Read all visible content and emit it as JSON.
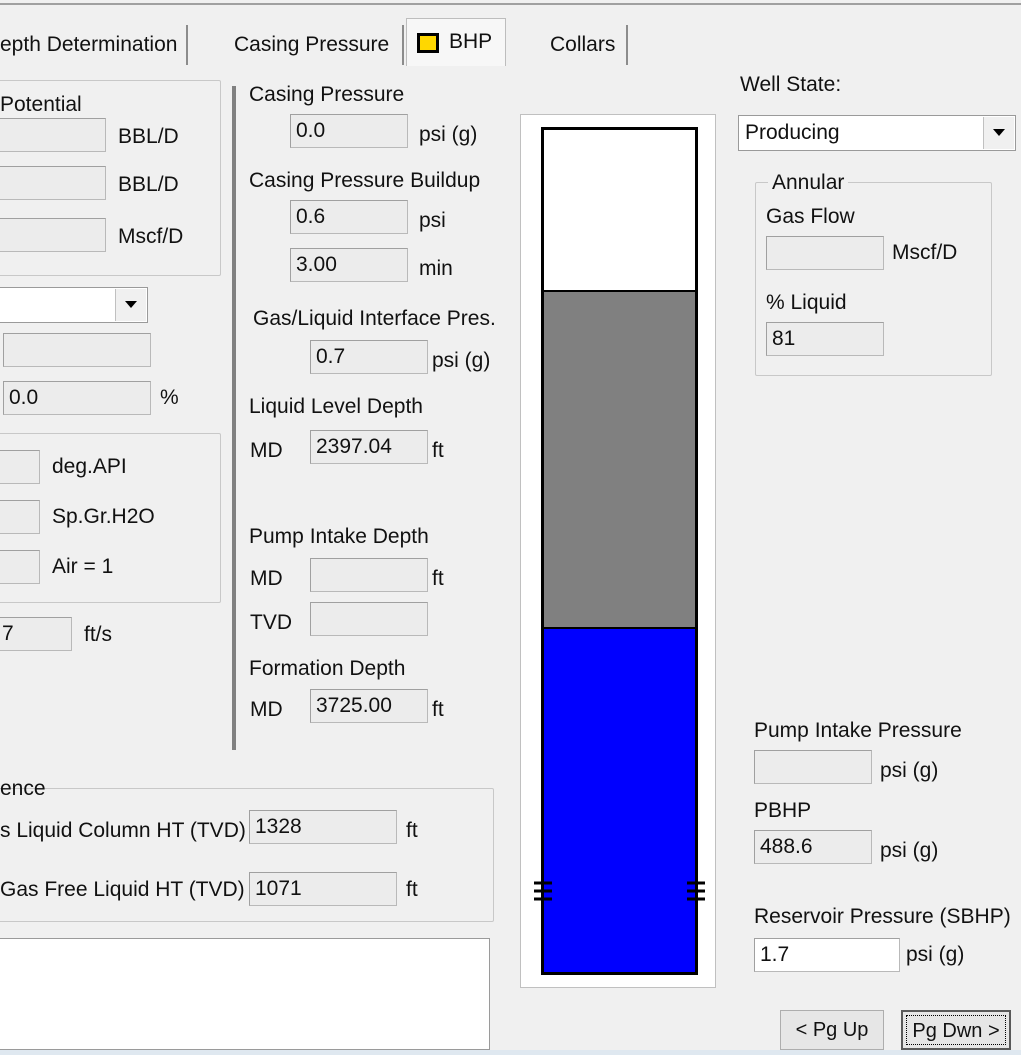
{
  "tabs": {
    "depth": "epth Determination",
    "casing": "Casing Pressure",
    "bhp": "BHP",
    "collars": "Collars"
  },
  "potential": {
    "legend": "Potential",
    "unit1": "BBL/D",
    "unit2": "BBL/D",
    "unit3": "Mscf/D"
  },
  "left": {
    "value_pct": "0.0",
    "pct_unit": "%",
    "unit_api": "deg.API",
    "unit_spgr": "Sp.Gr.H2O",
    "unit_air": "Air = 1",
    "velocity_value": "7",
    "velocity_unit": "ft/s"
  },
  "casing": {
    "title": "Casing Pressure",
    "value": "0.0",
    "unit": "psi (g)",
    "buildup_title": "Casing Pressure Buildup",
    "buildup_value": "0.6",
    "buildup_unit": "psi",
    "time_value": "3.00",
    "time_unit": "min",
    "interface_title": "Gas/Liquid Interface Pres.",
    "interface_value": "0.7",
    "interface_unit": "psi (g)"
  },
  "liquid_level": {
    "title": "Liquid Level Depth",
    "md_label": "MD",
    "md_value": "2397.04",
    "unit": "ft"
  },
  "pump_intake": {
    "title": "Pump Intake Depth",
    "md_label": "MD",
    "md_value": "",
    "unit": "ft",
    "tvd_label": "TVD",
    "tvd_value": ""
  },
  "formation": {
    "title": "Formation Depth",
    "md_label": "MD",
    "md_value": "3725.00",
    "unit": "ft"
  },
  "reference": {
    "legend": "ence",
    "row1_label": "s Liquid Column HT (TVD)",
    "row1_value": "1328",
    "row1_unit": "ft",
    "row2_label": "Gas Free Liquid HT (TVD)",
    "row2_value": "1071",
    "row2_unit": "ft"
  },
  "well_column": {
    "gas_fraction": 0.19,
    "liquid_gas_fraction": 0.4,
    "liquid_fraction": 0.41,
    "colors": {
      "top": "#ffffff",
      "gas": "#808080",
      "liquid": "#0000ff"
    }
  },
  "well_state": {
    "label": "Well State:",
    "value": "Producing"
  },
  "annular": {
    "legend": "Annular",
    "gas_flow_label": "Gas Flow",
    "gas_flow_value": "",
    "gas_flow_unit": "Mscf/D",
    "pct_liquid_label": "% Liquid",
    "pct_liquid_value": "81"
  },
  "pressures": {
    "pip_label": "Pump Intake Pressure",
    "pip_value": "",
    "pip_unit": "psi (g)",
    "pbhp_label": "PBHP",
    "pbhp_value": "488.6",
    "pbhp_unit": "psi (g)",
    "sbhp_label": "Reservoir Pressure (SBHP)",
    "sbhp_value": "1.7",
    "sbhp_unit": "psi (g)"
  },
  "nav": {
    "pg_up": "< Pg Up",
    "pg_dwn": "Pg Dwn >"
  },
  "colors": {
    "tab_icon": "#ffd700",
    "accent_line": "#808080"
  }
}
